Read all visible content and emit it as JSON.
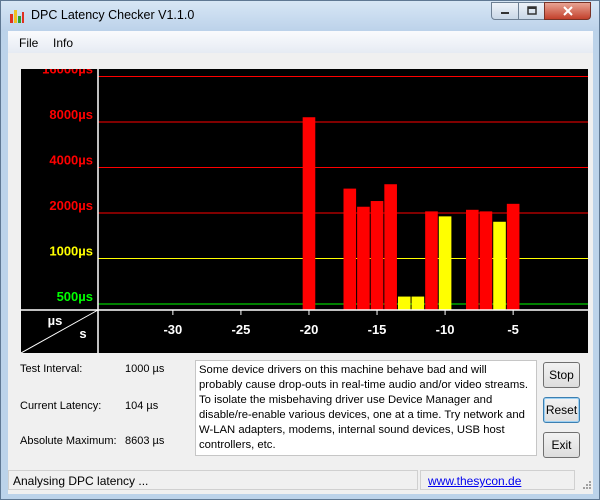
{
  "window": {
    "title": "DPC Latency Checker V1.1.0",
    "bg": "#bcd3ea"
  },
  "menu": [
    "File",
    "Info"
  ],
  "chart_data": {
    "type": "bar",
    "y_scale": "log2",
    "y_ticks": [
      "16000µs",
      "8000µs",
      "4000µs",
      "2000µs",
      "1000µs",
      "500µs"
    ],
    "y_tick_values": [
      16000,
      8000,
      4000,
      2000,
      1000,
      500
    ],
    "y_tick_colors": [
      "#ff0000",
      "#ff0000",
      "#ff0000",
      "#ff0000",
      "#ffff00",
      "#00ff00"
    ],
    "x_ticks": [
      "-30",
      "-25",
      "-20",
      "-15",
      "-10",
      "-5"
    ],
    "x_tick_values": [
      -30,
      -25,
      -20,
      -15,
      -10,
      -5
    ],
    "xlim": [
      -35,
      0
    ],
    "axis_unit_y": "µs",
    "axis_unit_x": "s",
    "colors": {
      "green": "#00ff00",
      "yellow": "#ffff00",
      "red": "#ff0000"
    },
    "bars": [
      {
        "x": -34,
        "y": 420
      },
      {
        "x": -33,
        "y": 310
      },
      {
        "x": -32,
        "y": 305
      },
      {
        "x": -31,
        "y": 315
      },
      {
        "x": -30,
        "y": 330
      },
      {
        "x": -29,
        "y": 350
      },
      {
        "x": -28,
        "y": 315
      },
      {
        "x": -27,
        "y": 315
      },
      {
        "x": -26,
        "y": 330
      },
      {
        "x": -25,
        "y": 345
      },
      {
        "x": -24,
        "y": 345
      },
      {
        "x": -23,
        "y": 380
      },
      {
        "x": -22,
        "y": 350
      },
      {
        "x": -21,
        "y": 300
      },
      {
        "x": -20,
        "y": 8603
      },
      {
        "x": -19,
        "y": 300
      },
      {
        "x": -18,
        "y": 300
      },
      {
        "x": -17,
        "y": 2900
      },
      {
        "x": -16,
        "y": 2200
      },
      {
        "x": -15,
        "y": 2400
      },
      {
        "x": -14,
        "y": 3100
      },
      {
        "x": -13,
        "y": 560
      },
      {
        "x": -12,
        "y": 560
      },
      {
        "x": -11,
        "y": 2050
      },
      {
        "x": -10,
        "y": 1900
      },
      {
        "x": -9,
        "y": 380
      },
      {
        "x": -8,
        "y": 2100
      },
      {
        "x": -7,
        "y": 2050
      },
      {
        "x": -6,
        "y": 1750
      },
      {
        "x": -5,
        "y": 2300
      },
      {
        "x": -4,
        "y": 310
      },
      {
        "x": -3,
        "y": 350
      },
      {
        "x": -2,
        "y": 330
      },
      {
        "x": -1,
        "y": 345
      },
      {
        "x": 0,
        "y": 320
      }
    ]
  },
  "info": {
    "test_interval_label": "Test Interval:",
    "test_interval_value": "1000 µs",
    "current_latency_label": "Current Latency:",
    "current_latency_value": "104 µs",
    "absolute_max_label": "Absolute Maximum:",
    "absolute_max_value": "8603 µs"
  },
  "description": "Some device drivers on this machine behave bad and will probably cause drop-outs in real-time audio and/or video streams. To isolate the misbehaving driver use Device Manager and disable/re-enable various devices, one at a time. Try network and W-LAN adapters, modems, internal sound devices, USB host controllers, etc.",
  "buttons": {
    "stop": "Stop",
    "reset": "Reset",
    "exit": "Exit"
  },
  "status": {
    "text": "Analysing DPC latency ...",
    "link": "www.thesycon.de"
  }
}
